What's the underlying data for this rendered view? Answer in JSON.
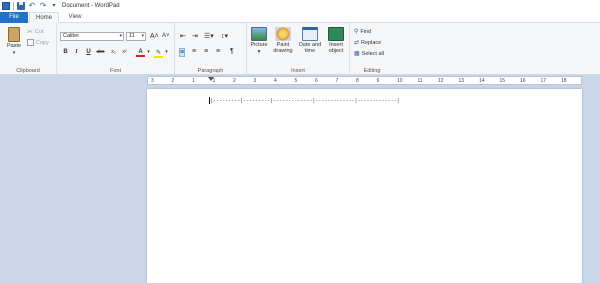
{
  "window": {
    "title": "Document - WordPad"
  },
  "tabs": {
    "file": "File",
    "home": "Home",
    "view": "View"
  },
  "clipboard": {
    "paste": "Paste",
    "cut": "Cut",
    "copy": "Copy",
    "label": "Clipboard"
  },
  "font": {
    "family": "Calibri",
    "size": "11",
    "label": "Font"
  },
  "paragraph": {
    "label": "Paragraph"
  },
  "insert": {
    "picture": "Picture",
    "paint_drawing": "Paint drawing",
    "date_time": "Date and time",
    "insert_object": "Insert object",
    "label": "Insert"
  },
  "editing": {
    "find": "Find",
    "replace": "Replace",
    "select_all": "Select all",
    "label": "Editing"
  },
  "ruler": {
    "ticks": [
      "3",
      "2",
      "1",
      "1",
      "2",
      "3",
      "4",
      "5",
      "6",
      "7",
      "8",
      "9",
      "10",
      "11",
      "12",
      "13",
      "14",
      "15",
      "16",
      "17",
      "18"
    ]
  },
  "document": {
    "text": "|---------|---------|-------------|-------------|-------------|"
  },
  "colors": {
    "accent": "#1e72c9",
    "page": "#ffffff",
    "workspace": "#c9d7e9"
  }
}
